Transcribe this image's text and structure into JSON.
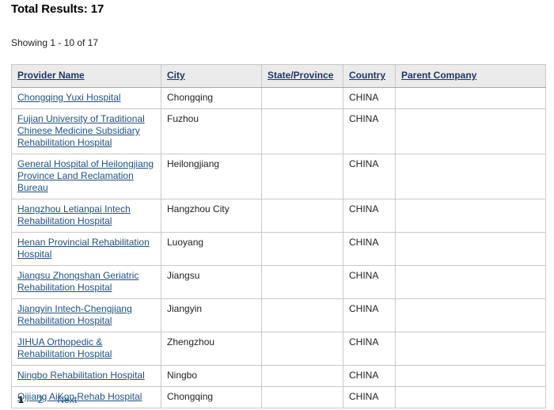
{
  "summary": {
    "total_results_label": "Total Results: 17",
    "showing_label": "Showing 1 - 10 of 17"
  },
  "table": {
    "columns": [
      {
        "key": "provider_name",
        "label": "Provider Name",
        "sortable": true
      },
      {
        "key": "city",
        "label": "City",
        "sortable": true
      },
      {
        "key": "state_province",
        "label": "State/Province",
        "sortable": true
      },
      {
        "key": "country",
        "label": "Country",
        "sortable": true
      },
      {
        "key": "parent_company",
        "label": "Parent Company",
        "sortable": true
      }
    ],
    "rows": [
      {
        "provider_name": "Chongqing Yuxi Hospital",
        "city": "Chongqing",
        "state_province": "",
        "country": "CHINA",
        "parent_company": ""
      },
      {
        "provider_name": "Fujian University of Traditional Chinese Medicine Subsidiary Rehabilitation Hospital",
        "city": "Fuzhou",
        "state_province": "",
        "country": "CHINA",
        "parent_company": ""
      },
      {
        "provider_name": "General Hospital of Heilongjiang Province Land Reclamation Bureau",
        "city": "Heilongjiang",
        "state_province": "",
        "country": "CHINA",
        "parent_company": ""
      },
      {
        "provider_name": "Hangzhou Letianpai Intech Rehabilitation Hospital",
        "city": "Hangzhou City",
        "state_province": "",
        "country": "CHINA",
        "parent_company": ""
      },
      {
        "provider_name": "Henan Provincial Rehabilitation Hospital",
        "city": "Luoyang",
        "state_province": "",
        "country": "CHINA",
        "parent_company": ""
      },
      {
        "provider_name": "Jiangsu Zhongshan Geriatric Rehabilitation Hospital",
        "city": "Jiangsu",
        "state_province": "",
        "country": "CHINA",
        "parent_company": ""
      },
      {
        "provider_name": "Jiangyin Intech-Chengjiang Rehabilitation Hospital",
        "city": "Jiangyin",
        "state_province": "",
        "country": "CHINA",
        "parent_company": ""
      },
      {
        "provider_name": "JIHUA Orthopedic & Rehabilitation Hospital",
        "city": "Zhengzhou",
        "state_province": "",
        "country": "CHINA",
        "parent_company": ""
      },
      {
        "provider_name": "Ningbo Rehabilitation Hospital",
        "city": "Ningbo",
        "state_province": "",
        "country": "CHINA",
        "parent_company": ""
      },
      {
        "provider_name": "Qijiang AiKon Rehab Hospital",
        "city": "Chongqing",
        "state_province": "",
        "country": "CHINA",
        "parent_company": ""
      }
    ]
  },
  "pagination": {
    "items": [
      {
        "label": "1",
        "current": true
      },
      {
        "label": "2",
        "current": false
      },
      {
        "label": "Next",
        "current": false
      }
    ]
  },
  "colors": {
    "header_link": "#1f3864",
    "cell_link": "#1f5182",
    "header_background": "#ebebeb",
    "table_border": "#a9a9a9",
    "cell_border": "#c8c8c8",
    "pagination_link": "#21578a"
  }
}
